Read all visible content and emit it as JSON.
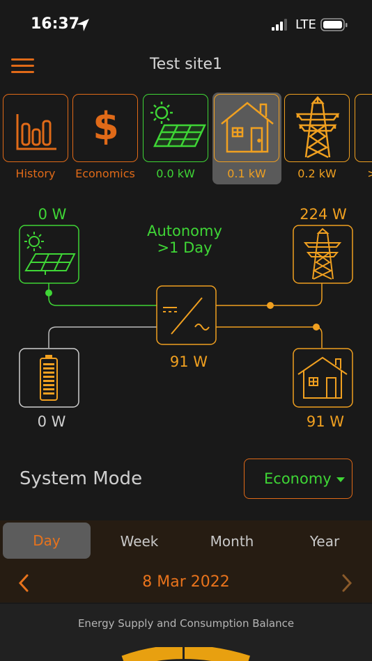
{
  "status_bar": {
    "time": "16:37",
    "carrier": "LTE"
  },
  "header": {
    "title": "Test site1"
  },
  "tiles": [
    {
      "label": "History",
      "icon": "bar-chart-icon",
      "color": "#e06a18"
    },
    {
      "label": "Economics",
      "icon": "dollar-icon",
      "color": "#e06a18"
    },
    {
      "label": "0.0  kW",
      "icon": "solar-panel-icon",
      "color": "#3fd636"
    },
    {
      "label": "0.1  kW",
      "icon": "house-icon",
      "color": "#f0a020",
      "selected": true
    },
    {
      "label": "0.2  kW",
      "icon": "power-tower-icon",
      "color": "#f0a020"
    },
    {
      "label": ">",
      "icon": "more-icon",
      "color": "#f0a020"
    }
  ],
  "diagram": {
    "solar": {
      "value": "0 W"
    },
    "autonomy": {
      "label": "Autonomy",
      "value": ">1 Day"
    },
    "grid": {
      "value": "224 W"
    },
    "inverter": {
      "value": "91 W"
    },
    "battery": {
      "value": "0 W"
    },
    "load": {
      "value": "91 W"
    }
  },
  "system_mode": {
    "label": "System Mode",
    "value": "Economy"
  },
  "period_tabs": {
    "day": "Day",
    "week": "Week",
    "month": "Month",
    "year": "Year",
    "selected": "Day"
  },
  "date_nav": {
    "date": "8 Mar 2022"
  },
  "card": {
    "title": "Energy Supply and Consumption Balance"
  },
  "colors": {
    "orange": "#e06a18",
    "amber": "#f0a020",
    "green": "#3fd636",
    "gray": "#d0d0d0",
    "background": "#191919"
  }
}
